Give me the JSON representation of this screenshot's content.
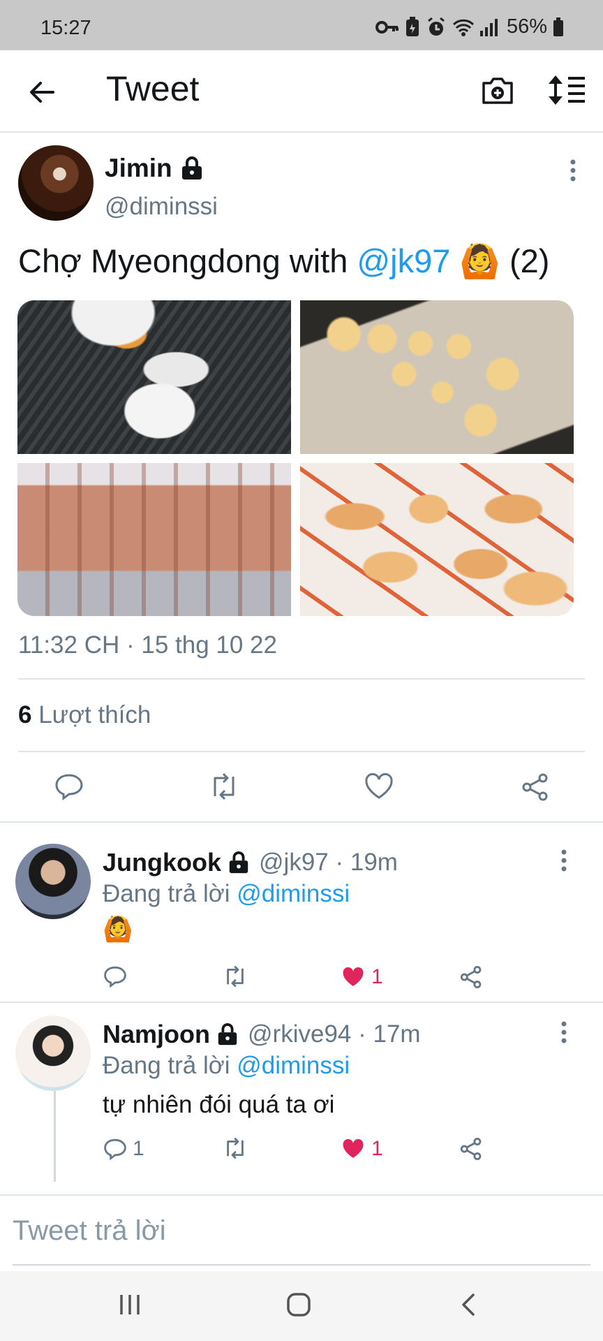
{
  "status_bar": {
    "time": "15:27",
    "battery": "56%",
    "icons": [
      "vpn-key-icon",
      "battery-saver-icon",
      "alarm-icon",
      "wifi-icon",
      "signal-icon",
      "battery-icon"
    ]
  },
  "header": {
    "title": "Tweet",
    "icons": [
      "back-arrow-icon",
      "camera-add-icon",
      "sort-icon"
    ]
  },
  "tweet": {
    "author_name": "Jimin",
    "author_handle": "@diminssi",
    "text_before": "Chợ Myeongdong with ",
    "mention": "@jk97",
    "emoji": "🙆",
    "text_after": " (2)",
    "timestamp": "11:32 CH · 15 thg 10 22",
    "likes_count": "6",
    "likes_label": " Lượt thích",
    "images": [
      "hotteok-griddle-photo",
      "crab-cups-photo",
      "taiyaki-photo",
      "crab-plates-photo"
    ]
  },
  "replies": [
    {
      "name": "Jungkook",
      "meta": "@jk97 · 19m",
      "replying_prefix": "Đang trả lời ",
      "replying_to": "@diminssi",
      "body": "🙆",
      "reply_count": "",
      "like_count": "1",
      "liked": true
    },
    {
      "name": "Namjoon",
      "meta": "@rkive94 · 17m",
      "replying_prefix": "Đang trả lời ",
      "replying_to": "@diminssi",
      "body": "tự nhiên đói quá ta ơi",
      "reply_count": "1",
      "like_count": "1",
      "liked": true
    }
  ],
  "compose": {
    "placeholder": "Tweet trả lời"
  },
  "colors": {
    "accent": "#1d9bf0",
    "like": "#e0245e",
    "secondary_text": "#657786"
  }
}
